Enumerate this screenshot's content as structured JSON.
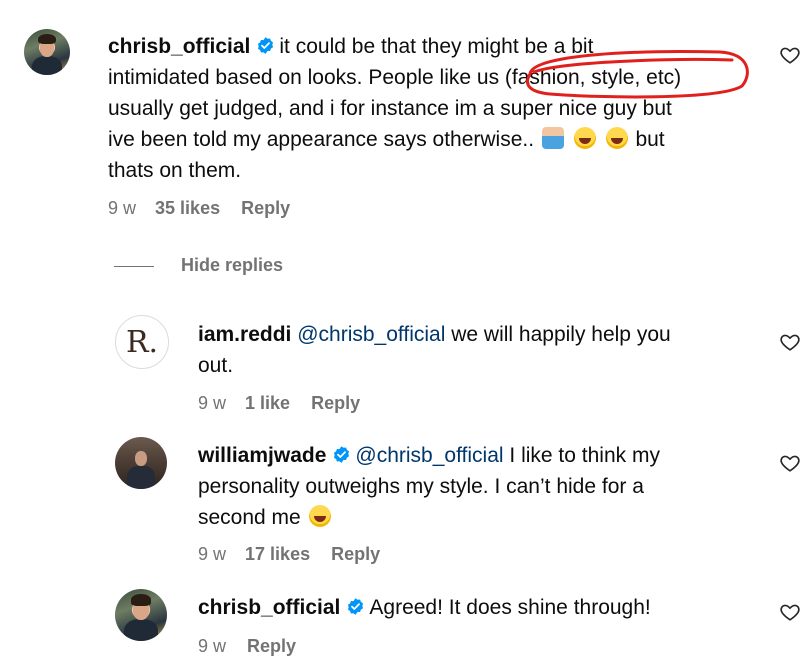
{
  "comments": {
    "main": {
      "username": "chrisb_official",
      "text_1": "it could be that they might be a bit",
      "text_2": "intimidated based on looks. People like us ",
      "text_highlight": "(fashion, style, etc)",
      "text_3": "usually get judged, and i for instance im a super nice guy but",
      "text_4": "ive been told my appearance says otherwise..",
      "text_5": "but",
      "text_6": "thats on them.",
      "time": "9 w",
      "likes": "35 likes",
      "reply": "Reply",
      "annotation_color": "#e0201c"
    },
    "hide_replies": "Hide replies",
    "replies": [
      {
        "username": "iam.reddi",
        "avatar_letter": "R.",
        "mention": "@chrisb_official",
        "text_1": " we will happily help you",
        "text_2": "out.",
        "time": "9 w",
        "likes": "1 like",
        "reply": "Reply"
      },
      {
        "username": "williamjwade",
        "mention": "@chrisb_official",
        "text_1": " I like to think my",
        "text_2": "personality outweighs my style. I can’t hide for a",
        "text_3": "second me",
        "time": "9 w",
        "likes": "17 likes",
        "reply": "Reply"
      },
      {
        "username": "chrisb_official",
        "text_1": "Agreed! It does shine through!",
        "time": "9 w",
        "reply": "Reply"
      }
    ]
  },
  "icons": {
    "verified": "verified-badge-icon",
    "heart": "heart-outline-icon",
    "emoji_laugh": "face-with-tears-of-joy-icon",
    "emoji_shrug": "person-shrugging-icon"
  },
  "colors": {
    "mention": "#00376b",
    "verified": "#0095f6",
    "meta": "#737373"
  }
}
